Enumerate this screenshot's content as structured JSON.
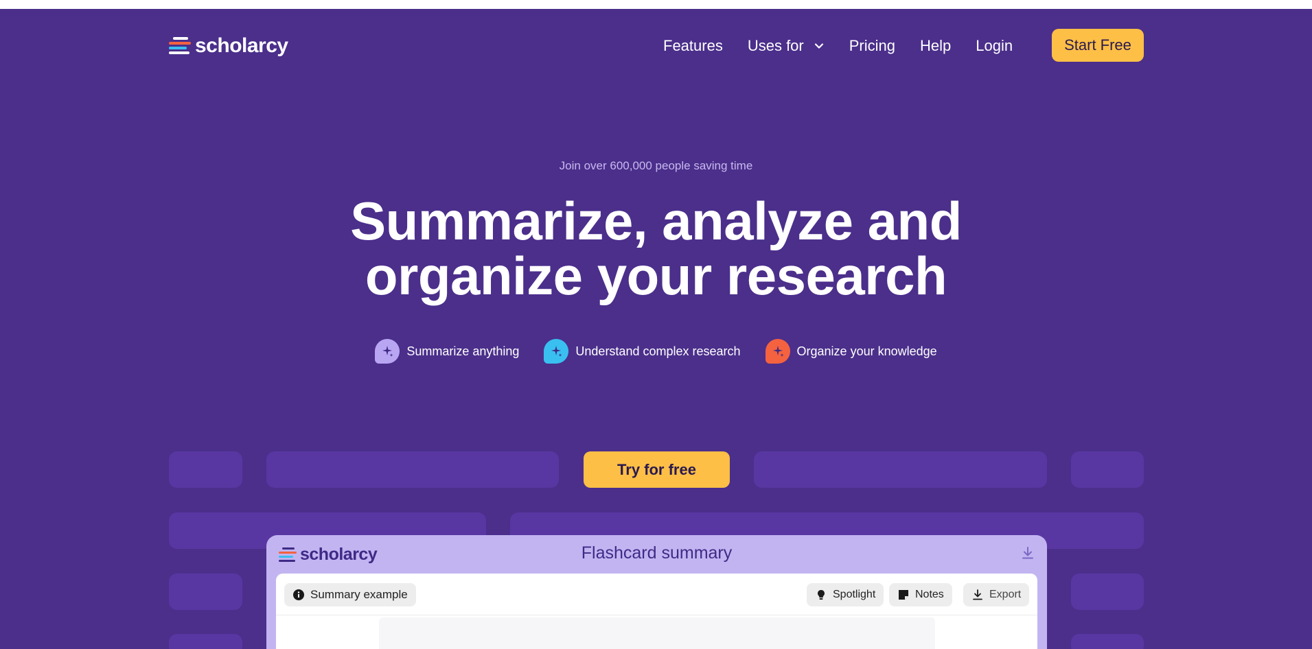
{
  "brand": {
    "name": "scholarcy"
  },
  "nav": {
    "features": "Features",
    "uses_for": "Uses for",
    "pricing": "Pricing",
    "help": "Help",
    "login": "Login",
    "start_free": "Start Free"
  },
  "hero": {
    "tagline": "Join over 600,000 people saving time",
    "headline_line1": "Summarize, analyze and",
    "headline_line2": "organize your research",
    "features": [
      {
        "label": "Summarize anything",
        "icon": "sparkle-icon",
        "color": "#b9a6f2"
      },
      {
        "label": "Understand complex research",
        "icon": "sparkle-icon",
        "color": "#39c0f0"
      },
      {
        "label": "Organize your knowledge",
        "icon": "sparkle-icon",
        "color": "#f4623f"
      }
    ],
    "try_button": "Try for free"
  },
  "preview": {
    "brand": "scholarcy",
    "title": "Flashcard summary",
    "summary_chip": "Summary example",
    "spotlight": "Spotlight",
    "notes": "Notes",
    "export": "Export"
  },
  "colors": {
    "background": "#4b2f8b",
    "pill": "#5937a2",
    "accent": "#fdbf46",
    "card": "#c2b4f1"
  }
}
